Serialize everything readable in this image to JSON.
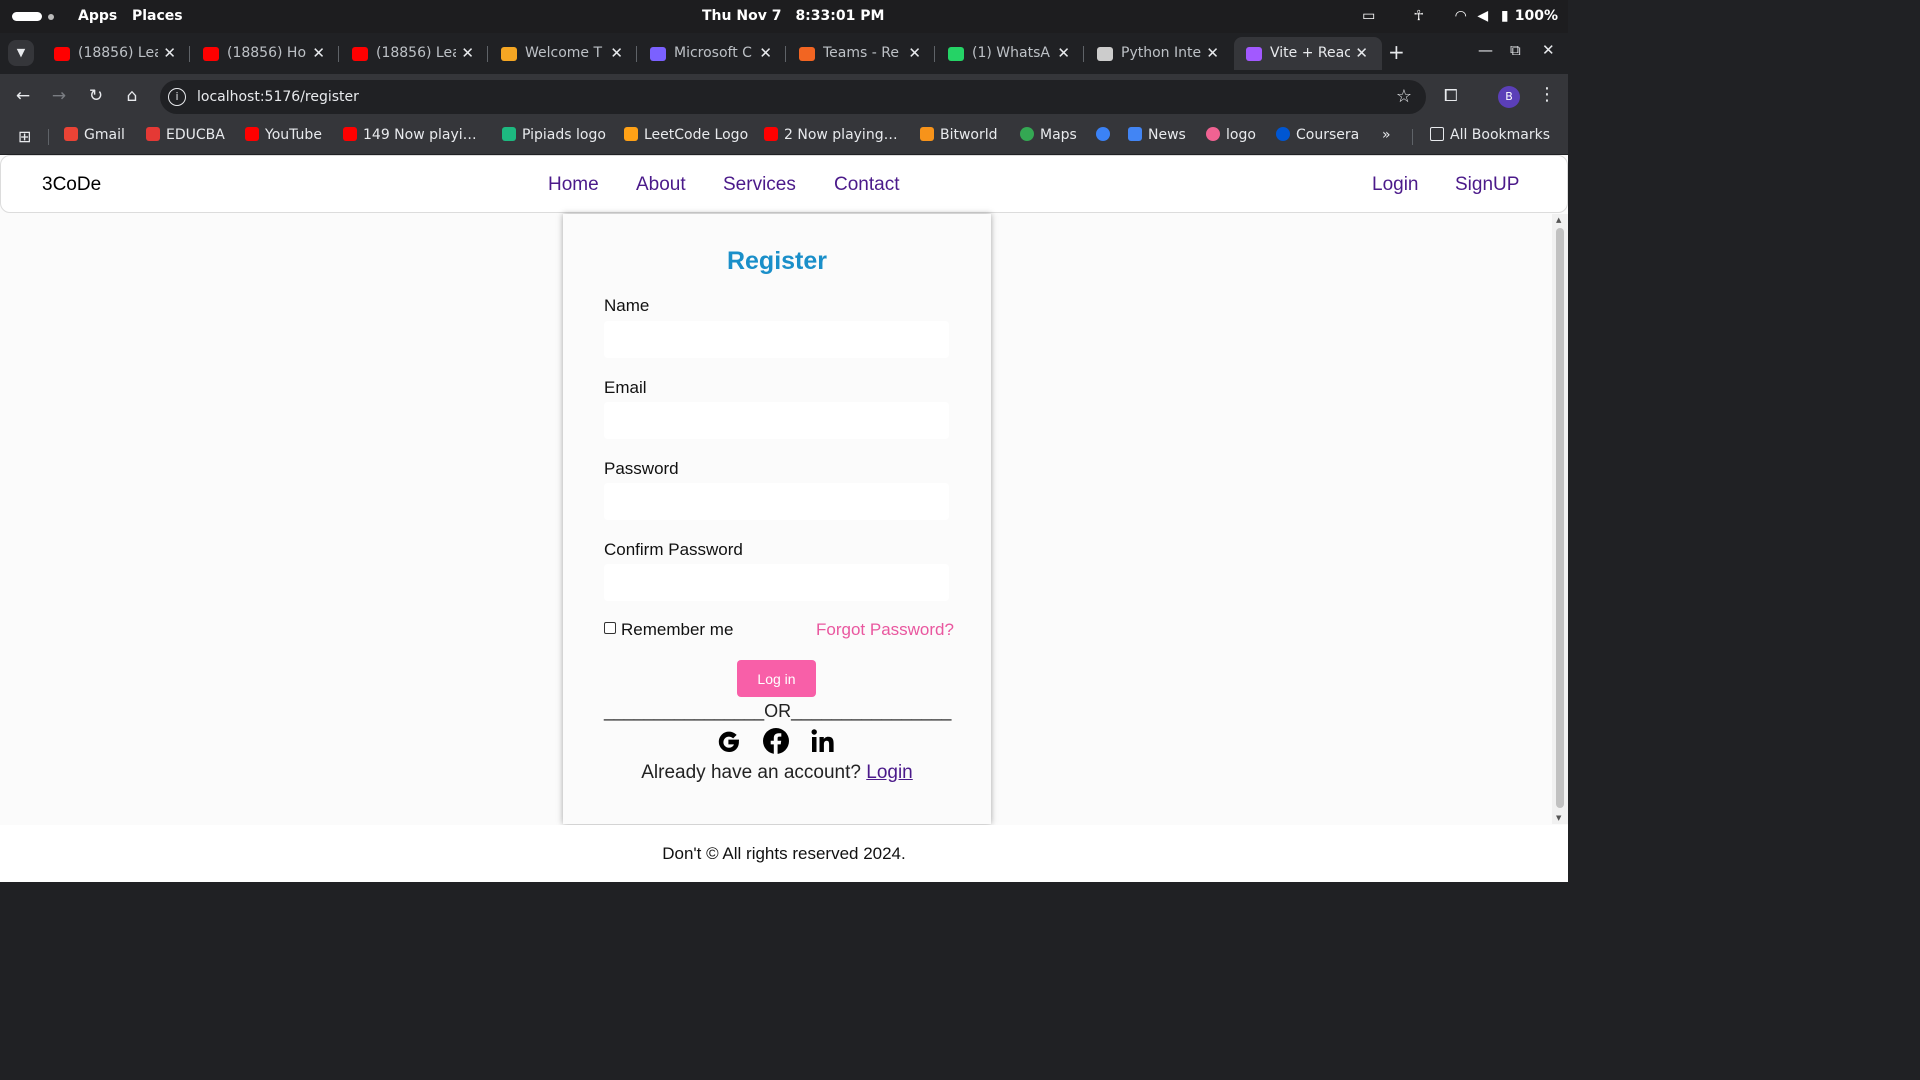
{
  "system_bar": {
    "apps_label": "Apps",
    "places_label": "Places",
    "date": "Thu Nov 7",
    "time": "8:33:01 PM",
    "battery": "100%"
  },
  "tabs": [
    {
      "title": "(18856) Lea",
      "favicon": "youtube-icon",
      "color": "#ff0000"
    },
    {
      "title": "(18856) Ho",
      "favicon": "youtube-icon",
      "color": "#ff0000"
    },
    {
      "title": "(18856) Lea",
      "favicon": "youtube-icon",
      "color": "#ff0000"
    },
    {
      "title": "Welcome T",
      "favicon": "infinity-icon",
      "color": "#f5a623"
    },
    {
      "title": "Microsoft C",
      "favicon": "copilot-icon",
      "color": "#7b61ff"
    },
    {
      "title": "Teams - Re",
      "favicon": "teams-icon",
      "color": "#f26522"
    },
    {
      "title": "(1) WhatsA",
      "favicon": "whatsapp-icon",
      "color": "#25d366"
    },
    {
      "title": "Python Inte",
      "favicon": "openai-icon",
      "color": "#cccccc"
    },
    {
      "title": "Vite + Reac",
      "favicon": "vite-icon",
      "color": "#a259ff",
      "active": true
    }
  ],
  "address_bar": {
    "url": "localhost:5176/register"
  },
  "profile_initial": "B",
  "bookmarks": [
    {
      "label": "Gmail",
      "icon": "gmail-icon",
      "color": "#ea4335"
    },
    {
      "label": "EDUCBA",
      "icon": "educba-icon",
      "color": "#e53935"
    },
    {
      "label": "YouTube",
      "icon": "youtube-icon",
      "color": "#ff0000"
    },
    {
      "label": "149 Now playi…",
      "icon": "youtube-icon",
      "color": "#ff0000"
    },
    {
      "label": "Pipiads logo",
      "icon": "pipiads-icon",
      "color": "#1db980"
    },
    {
      "label": "LeetCode Logo",
      "icon": "leetcode-icon",
      "color": "#ffa116"
    },
    {
      "label": "2 Now playing…",
      "icon": "youtube-icon",
      "color": "#ff0000"
    },
    {
      "label": "Bitworld",
      "icon": "bitworld-icon",
      "color": "#f7931a"
    },
    {
      "label": "Maps",
      "icon": "maps-icon",
      "color": "#34a853"
    },
    {
      "label": "",
      "icon": "messenger-icon",
      "color": "#3b82f6"
    },
    {
      "label": "News",
      "icon": "news-icon",
      "color": "#4285f4"
    },
    {
      "label": "logo",
      "icon": "logo-icon",
      "color": "#f06292"
    },
    {
      "label": "Coursera",
      "icon": "coursera-icon",
      "color": "#0056d2"
    }
  ],
  "bookmarks_more": "»",
  "all_bookmarks": "All Bookmarks",
  "site": {
    "brand": "3CoDe",
    "nav": [
      "Home",
      "About",
      "Services",
      "Contact"
    ],
    "auth": [
      "Login",
      "SignUP"
    ]
  },
  "form": {
    "title": "Register",
    "fields": [
      {
        "label": "Name",
        "value": "",
        "placeholder": ""
      },
      {
        "label": "Email",
        "value": "",
        "placeholder": ""
      },
      {
        "label": "Password",
        "value": "",
        "placeholder": ""
      },
      {
        "label": "Confirm Password",
        "value": "",
        "placeholder": ""
      }
    ],
    "remember_label": "Remember me",
    "forgot_label": "Forgot Password?",
    "submit_label": "Log in",
    "or_divider": "________________OR________________",
    "social": [
      "google-icon",
      "facebook-icon",
      "linkedin-icon"
    ],
    "already_text": "Already have an account?",
    "login_link": "Login"
  },
  "footer": "Don't © All rights reserved 2024.",
  "colors": {
    "title_blue": "#1a8fc9",
    "nav_purple": "#4b1a8a",
    "pink": "#f85fa8"
  }
}
